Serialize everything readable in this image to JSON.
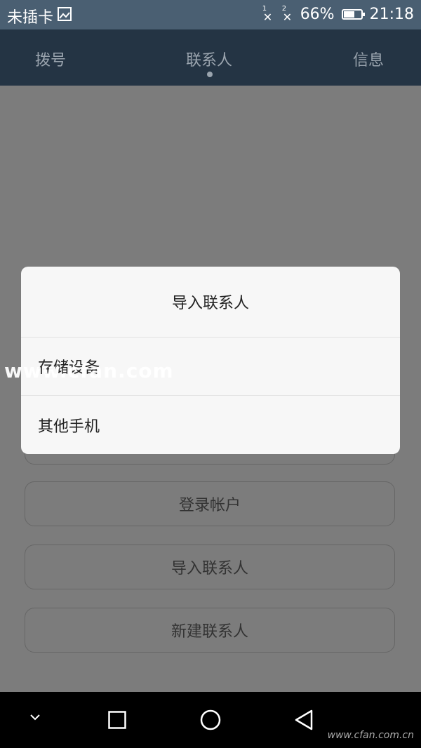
{
  "status_bar": {
    "carrier": "未插卡",
    "sim1_label": "1",
    "sim2_label": "2",
    "no_signal": "✕",
    "battery_percent": "66%",
    "battery_level": 0.66,
    "time": "21:18"
  },
  "tabs": {
    "dial": "拨号",
    "contacts": "联系人",
    "messages": "信息"
  },
  "dialog": {
    "title": "导入联系人",
    "options": [
      "存储设备",
      "其他手机"
    ]
  },
  "buttons": {
    "login": "登录帐户",
    "import": "导入联系人",
    "new": "新建联系人"
  },
  "watermark": "www.cfan.com",
  "corner_mark": "www.cfan.com.cn"
}
